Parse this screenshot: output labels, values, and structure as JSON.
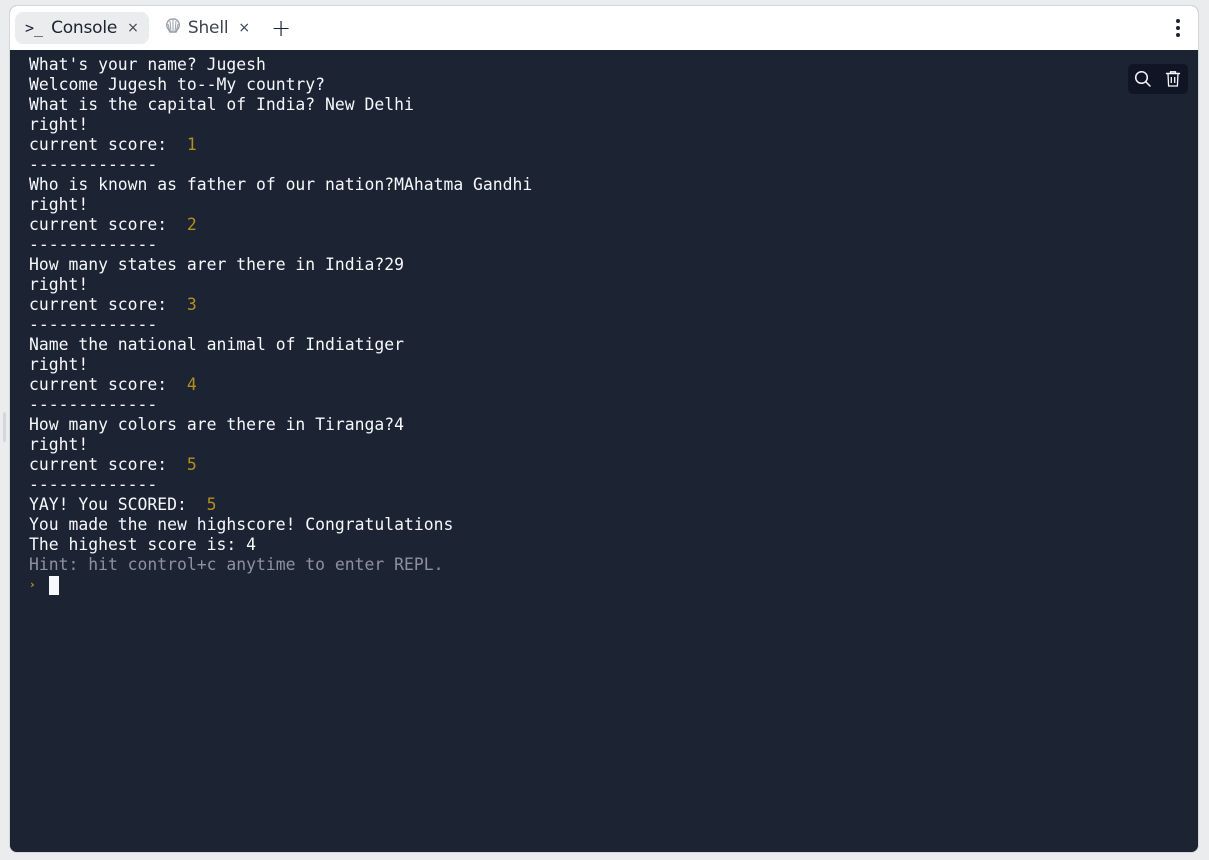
{
  "tabs": [
    {
      "label": "Console",
      "icon": "terminal-icon",
      "active": true,
      "close_glyph": "×"
    },
    {
      "label": "Shell",
      "icon": "shell-icon",
      "active": false,
      "close_glyph": "×"
    }
  ],
  "add_tab_glyph": "+",
  "console": {
    "lines": [
      {
        "text": "What's your name? Jugesh"
      },
      {
        "text": "Welcome Jugesh to--My country?"
      },
      {
        "text": "What is the capital of India? New Delhi"
      },
      {
        "text": "right!"
      },
      {
        "text": "current score:  ",
        "num": "1"
      },
      {
        "text": "-------------"
      },
      {
        "text": "Who is known as father of our nation?MAhatma Gandhi"
      },
      {
        "text": "right!"
      },
      {
        "text": "current score:  ",
        "num": "2"
      },
      {
        "text": "-------------"
      },
      {
        "text": "How many states arer there in India?29"
      },
      {
        "text": "right!"
      },
      {
        "text": "current score:  ",
        "num": "3"
      },
      {
        "text": "-------------"
      },
      {
        "text": "Name the national animal of Indiatiger"
      },
      {
        "text": "right!"
      },
      {
        "text": "current score:  ",
        "num": "4"
      },
      {
        "text": "-------------"
      },
      {
        "text": "How many colors are there in Tiranga?4"
      },
      {
        "text": "right!"
      },
      {
        "text": "current score:  ",
        "num": "5"
      },
      {
        "text": "-------------"
      },
      {
        "text": "YAY! You SCORED:  ",
        "num": "5"
      },
      {
        "text": "You made the new highscore! Congratulations"
      },
      {
        "text": "The highest score is: 4"
      }
    ],
    "hint": "Hint: hit control+c anytime to enter REPL.",
    "prompt_glyph": "›"
  },
  "actions": {
    "search": "search-icon",
    "clear": "trash-icon"
  },
  "colors": {
    "console_bg": "#1c2333",
    "number": "#b58f1e",
    "hint": "#8c929d",
    "text": "#f5f9fc"
  }
}
